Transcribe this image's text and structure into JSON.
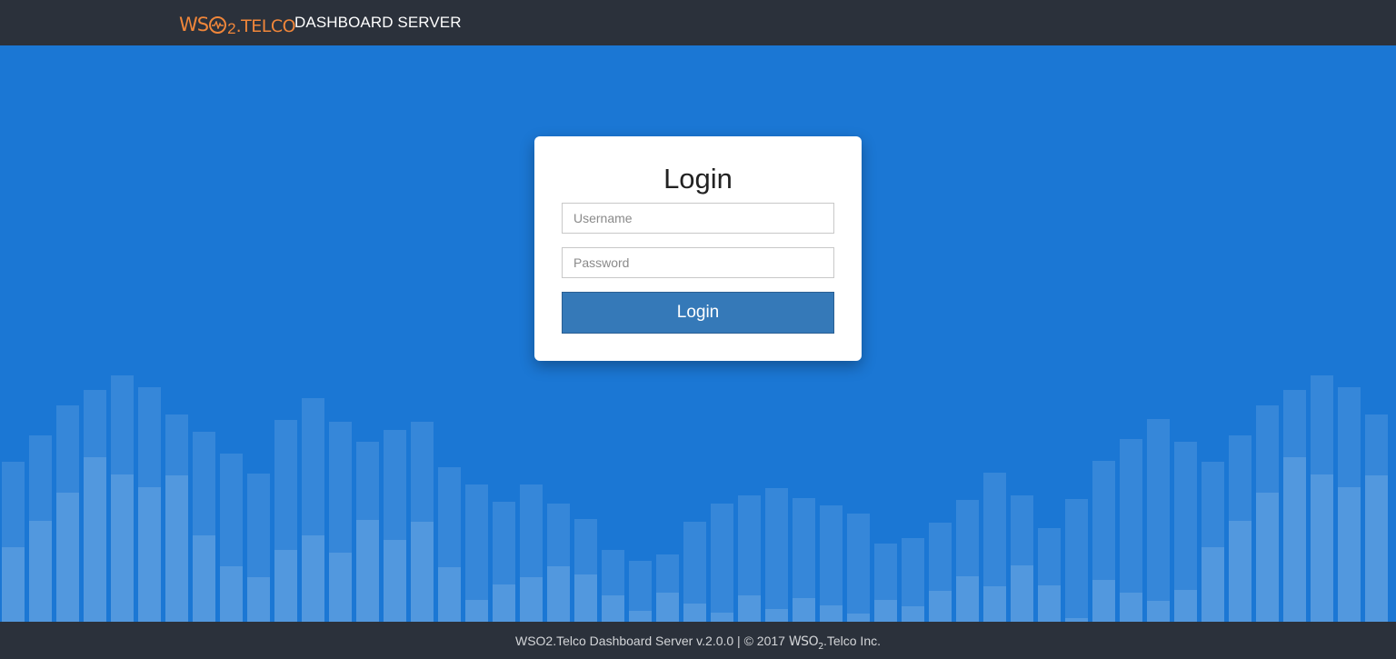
{
  "header": {
    "logo": {
      "part1": "WS",
      "part2": "2",
      "part3": "TELCO",
      "color": "#f0863a"
    },
    "app_title": "DASHBOARD SERVER"
  },
  "login": {
    "title": "Login",
    "username_placeholder": "Username",
    "password_placeholder": "Password",
    "button_label": "Login"
  },
  "footer": {
    "text_before": "WSO2.Telco Dashboard Server v.2.0.0 | © 2017 ",
    "logo_part1": "WS",
    "logo_part2": "O",
    "logo_sub": "2",
    "text_after": ".Telco Inc."
  },
  "colors": {
    "header_bg": "#2b313b",
    "main_bg": "#1b77d4",
    "button_bg": "#3579b8",
    "accent": "#f0863a"
  }
}
